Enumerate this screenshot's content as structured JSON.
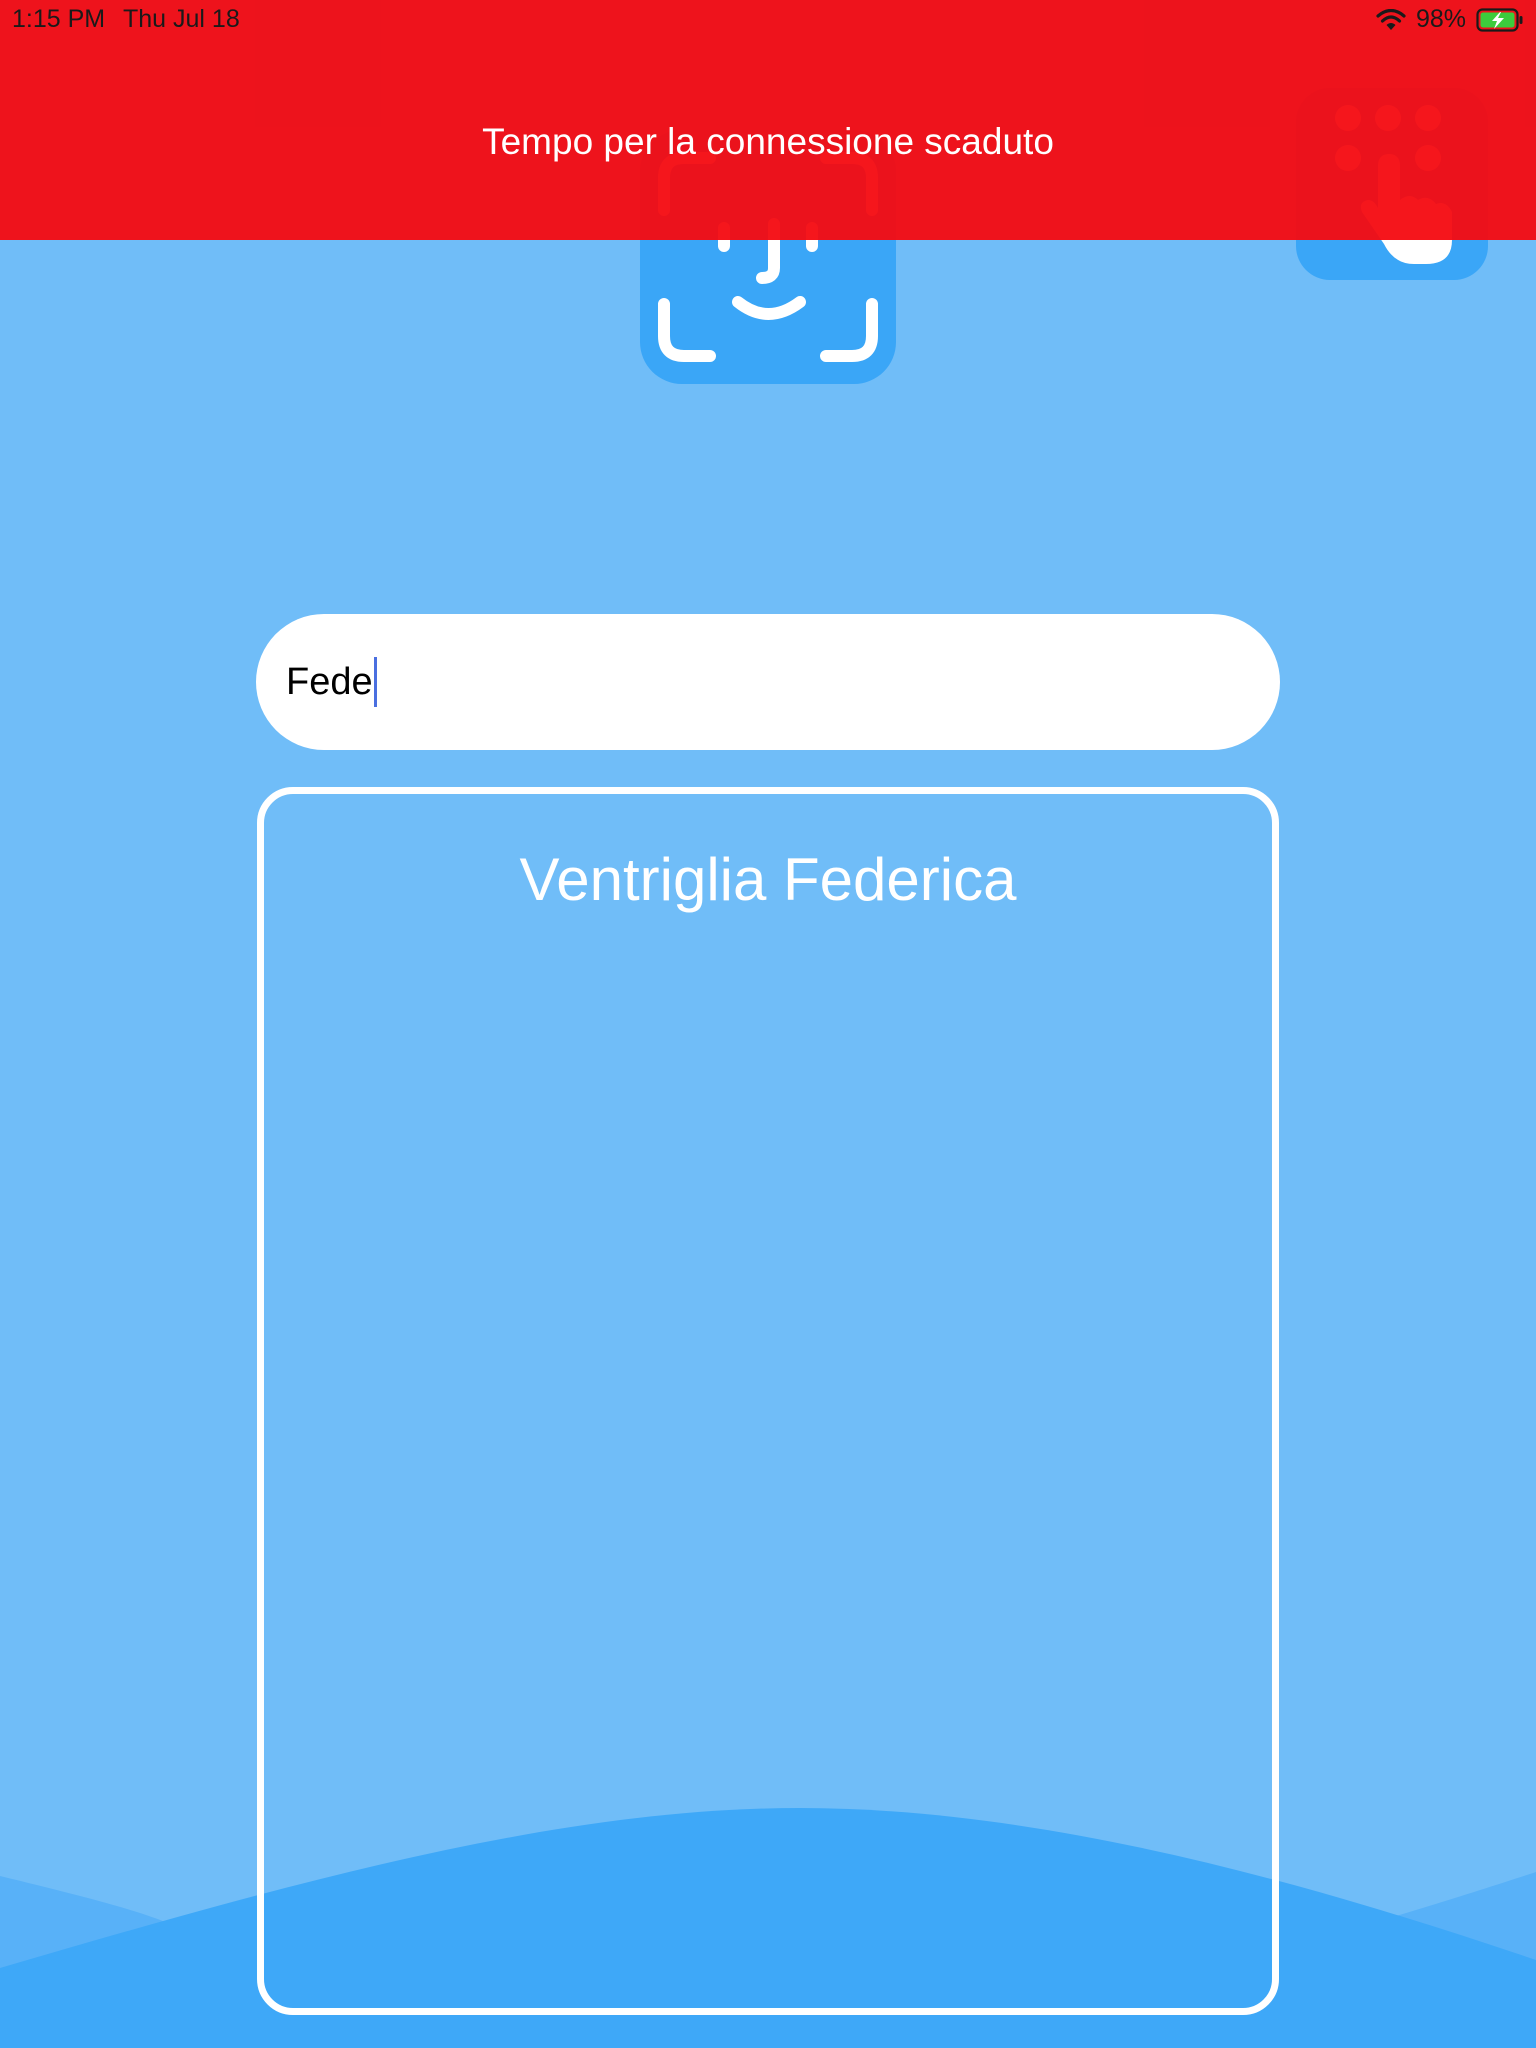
{
  "status_bar": {
    "time": "1:15 PM",
    "date": "Thu Jul 18",
    "battery_percent": "98%",
    "icons": [
      "wifi-icon",
      "battery-charging-icon"
    ]
  },
  "toast": {
    "message": "Tempo per la connessione scaduto",
    "color": "#f40a10"
  },
  "icons": {
    "face_id": "face-id-icon",
    "passcode": "keypad-tap-icon"
  },
  "search": {
    "value": "Fede"
  },
  "results": [
    {
      "name": "Ventriglia Federica"
    }
  ],
  "theme": {
    "background": "#70bdf8",
    "accent": "#3aa6f7",
    "wave": "#3aa6f7"
  }
}
